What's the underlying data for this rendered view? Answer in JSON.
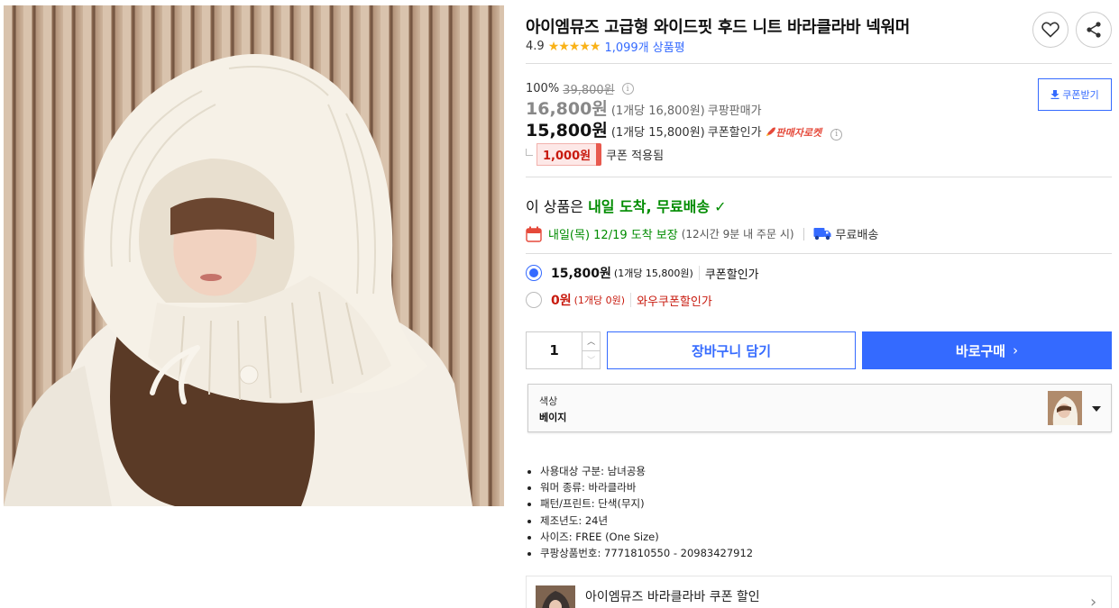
{
  "product": {
    "title": "아이엠뮤즈 고급형 와이드핏 후드 니트 바라클라바 넥워머",
    "rating": "4.9",
    "stars": "★★★★★",
    "review_count": "1,099개 상품평"
  },
  "price": {
    "discount_rate": "100%",
    "original_price": "39,800원",
    "sale_price": "16,800원",
    "sale_unit": "(1개당 16,800원)",
    "sale_label": "쿠팡판매가",
    "coupon_price": "15,800원",
    "coupon_unit": "(1개당 15,800원)",
    "coupon_label": "쿠폰할인가",
    "seller_badge": "판매자로켓",
    "coupon_download": "쿠폰받기",
    "coupon_amount": "1,000원",
    "coupon_applied": "쿠폰 적용됨"
  },
  "delivery": {
    "head_prefix": "이 상품은",
    "head_highlight": "내일 도착, 무료배송",
    "check": "✓",
    "arrival": "내일(목) 12/19 도착 보장",
    "condition": "(12시간 9분 내 주문 시)",
    "free_shipping": "무료배송"
  },
  "options": [
    {
      "price": "15,800원",
      "unit": "(1개당 15,800원)",
      "label": "쿠폰할인가",
      "selected": true
    },
    {
      "price": "0원",
      "unit": "(1개당 0원)",
      "label": "와우쿠폰할인가",
      "selected": false
    }
  ],
  "purchase": {
    "quantity": "1",
    "cart_label": "장바구니 담기",
    "buy_label": "바로구매",
    "buy_chevron": "›"
  },
  "color_select": {
    "label": "색상",
    "value": "베이지"
  },
  "attributes": [
    "사용대상 구분: 남녀공용",
    "워머 종류: 바라클라바",
    "패턴/프린트: 단색(무지)",
    "제조년도: 24년",
    "사이즈: FREE (One Size)",
    "쿠팡상품번호: 7771810550 - 20983427912"
  ],
  "promo": {
    "text": "아이엠뮤즈 바라클라바 쿠폰 할인",
    "chevron": "›"
  },
  "colors": {
    "accent": "#346aff",
    "green": "#008c00",
    "red": "#c81a0e",
    "star": "#f9b218"
  },
  "icons": [
    "heart-icon",
    "share-icon",
    "info-icon",
    "download-icon",
    "rocket-icon",
    "calendar-icon",
    "truck-icon",
    "chevron-right-icon",
    "caret-down-icon"
  ]
}
